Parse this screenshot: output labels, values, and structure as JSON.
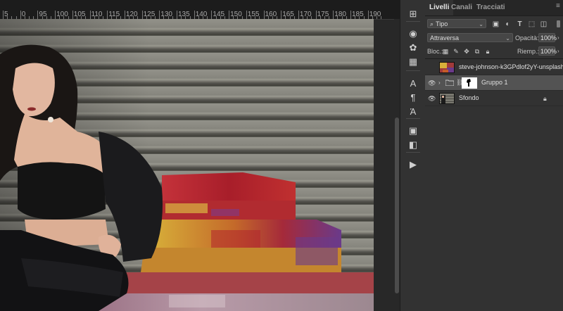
{
  "ruler": {
    "numbers": [
      "5",
      "0",
      "95",
      "100",
      "105",
      "110",
      "115",
      "120",
      "125",
      "130",
      "135",
      "140",
      "145",
      "150",
      "155",
      "160",
      "165",
      "170",
      "175",
      "180",
      "185",
      "190"
    ]
  },
  "tools": [
    {
      "name": "properties-icon",
      "glyph": "⊞"
    },
    {
      "name": "adjustments-icon",
      "glyph": "◉"
    },
    {
      "name": "color-wheel-icon",
      "glyph": "✿"
    },
    {
      "name": "swatches-grid-icon",
      "glyph": "▦"
    },
    {
      "name": "character-icon",
      "glyph": "A"
    },
    {
      "name": "paragraph-icon",
      "glyph": "¶"
    },
    {
      "name": "glyphs-icon",
      "glyph": "Ά"
    },
    {
      "name": "layer-comps-icon",
      "glyph": "▣"
    },
    {
      "name": "libraries-icon",
      "glyph": "◧"
    },
    {
      "name": "actions-play-icon",
      "glyph": "▶"
    }
  ],
  "panel": {
    "tabs": [
      "Livelli",
      "Canali",
      "Tracciati"
    ],
    "filter": {
      "label": "Tipo"
    },
    "blend_mode": "Attraversa",
    "opacity_label": "Opacità:",
    "opacity_value": "100%",
    "lock_label": "Bloc.:",
    "fill_label": "Riemp.:",
    "fill_value": "100%",
    "layers": [
      {
        "name": "steve-johnson-k3GPdlof2yY-unsplash",
        "visible": false,
        "selected": false,
        "type": "image"
      },
      {
        "name": "Gruppo 1",
        "visible": true,
        "selected": true,
        "type": "group-mask"
      },
      {
        "name": "Sfondo",
        "visible": true,
        "selected": false,
        "type": "background",
        "locked": true
      }
    ]
  },
  "colors": {
    "panel_bg": "#323232",
    "selected_layer": "#535353",
    "paint_red": "#b8242a",
    "paint_yellow": "#d6b13a"
  }
}
